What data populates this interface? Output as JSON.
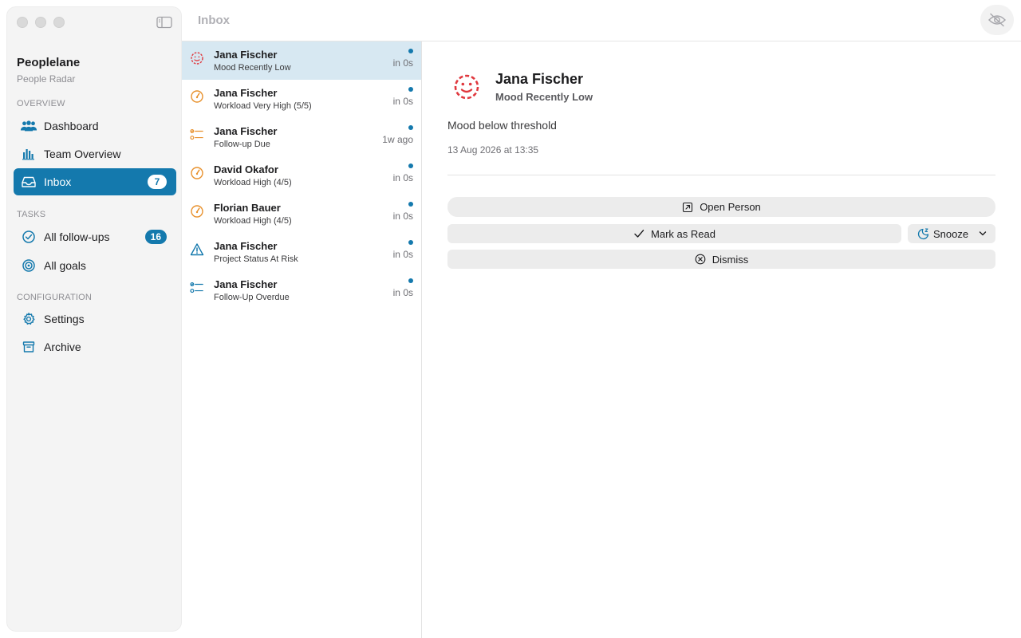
{
  "window": {
    "title": "Inbox"
  },
  "sidebar": {
    "app_title": "Peoplelane",
    "app_subtitle": "People Radar",
    "sections": {
      "overview": "OVERVIEW",
      "tasks": "TASKS",
      "configuration": "CONFIGURATION"
    },
    "items": [
      {
        "label": "Dashboard",
        "icon": "people-icon"
      },
      {
        "label": "Team Overview",
        "icon": "bar-chart-icon"
      },
      {
        "label": "Inbox",
        "icon": "inbox-tray-icon",
        "badge": "7",
        "active": true
      },
      {
        "label": "All follow-ups",
        "icon": "check-circle-icon",
        "badge": "16"
      },
      {
        "label": "All goals",
        "icon": "target-icon"
      },
      {
        "label": "Settings",
        "icon": "gear-icon"
      },
      {
        "label": "Archive",
        "icon": "archive-box-icon"
      }
    ]
  },
  "inbox": {
    "items": [
      {
        "name": "Jana Fischer",
        "subtitle": "Mood Recently Low",
        "time": "in 0s",
        "icon": "sad-face-icon",
        "unread": true,
        "selected": true
      },
      {
        "name": "Jana Fischer",
        "subtitle": "Workload Very High (5/5)",
        "time": "in 0s",
        "icon": "gauge-icon",
        "unread": true
      },
      {
        "name": "Jana Fischer",
        "subtitle": "Follow-up Due",
        "time": "1w ago",
        "icon": "checklist-icon",
        "unread": true
      },
      {
        "name": "David Okafor",
        "subtitle": "Workload High (4/5)",
        "time": "in 0s",
        "icon": "gauge-icon",
        "unread": true
      },
      {
        "name": "Florian Bauer",
        "subtitle": "Workload High (4/5)",
        "time": "in 0s",
        "icon": "gauge-icon",
        "unread": true
      },
      {
        "name": "Jana Fischer",
        "subtitle": "Project Status At Risk",
        "time": "in 0s",
        "icon": "warning-triangle-icon",
        "unread": true
      },
      {
        "name": "Jana Fischer",
        "subtitle": "Follow-Up Overdue",
        "time": "in 0s",
        "icon": "checklist-icon",
        "unread": true
      }
    ]
  },
  "detail": {
    "name": "Jana Fischer",
    "subtitle": "Mood Recently Low",
    "message": "Mood below threshold",
    "date": "13 Aug 2026 at 13:35",
    "actions": {
      "open": "Open Person",
      "mark_read": "Mark as Read",
      "snooze": "Snooze",
      "dismiss": "Dismiss"
    }
  },
  "colors": {
    "accent": "#1479ad",
    "mood_red": "#e0383e",
    "workload_orange": "#e8912d",
    "selection": "#d7e8f2"
  }
}
